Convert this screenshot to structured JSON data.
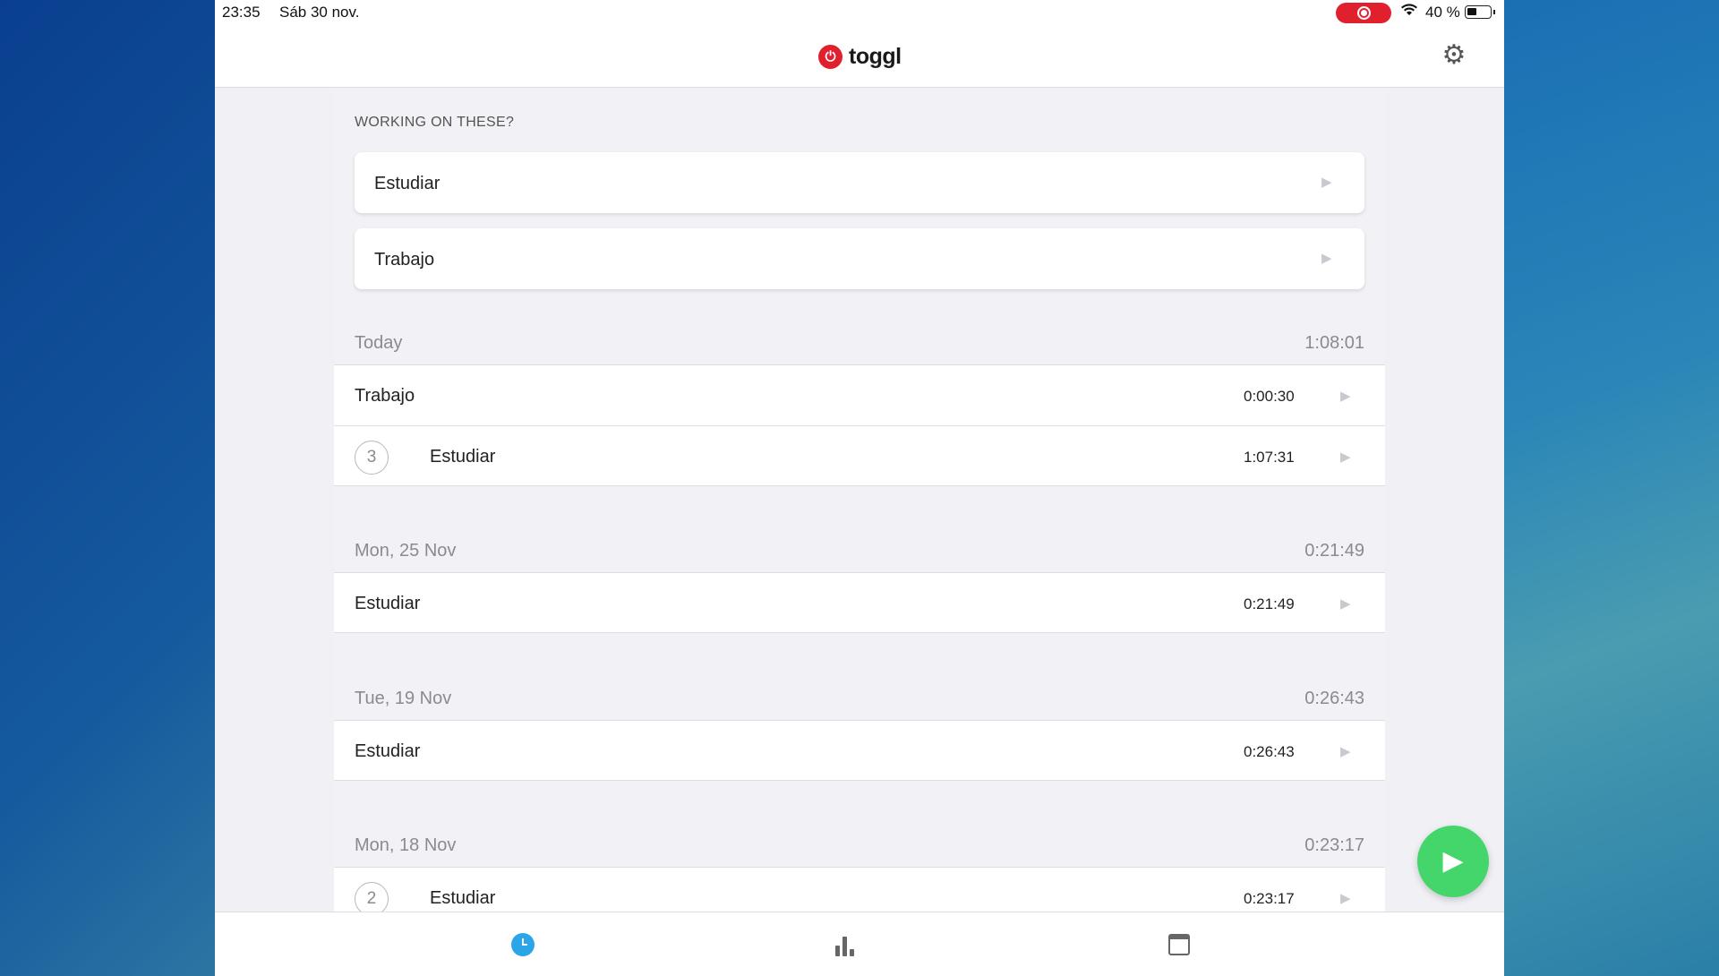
{
  "status_bar": {
    "time": "23:35",
    "date": "Sáb 30 nov.",
    "battery": "40 %",
    "recording_color": "#e0202d"
  },
  "header": {
    "logo_text": "toggl",
    "brand_color": "#e0202d",
    "settings_icon": "gear-icon"
  },
  "suggestions": {
    "title": "WORKING ON THESE?",
    "items": [
      {
        "label": "Estudiar"
      },
      {
        "label": "Trabajo"
      }
    ]
  },
  "groups": [
    {
      "date": "Today",
      "total": "1:08:01",
      "entries": [
        {
          "name": "Trabajo",
          "duration": "0:00:30"
        },
        {
          "count": "3",
          "name": "Estudiar",
          "duration": "1:07:31"
        }
      ]
    },
    {
      "date": "Mon, 25 Nov",
      "total": "0:21:49",
      "entries": [
        {
          "name": "Estudiar",
          "duration": "0:21:49"
        }
      ]
    },
    {
      "date": "Tue, 19 Nov",
      "total": "0:26:43",
      "entries": [
        {
          "name": "Estudiar",
          "duration": "0:26:43"
        }
      ]
    },
    {
      "date": "Mon, 18 Nov",
      "total": "0:23:17",
      "entries": [
        {
          "count": "2",
          "name": "Estudiar",
          "duration": "0:23:17"
        }
      ]
    }
  ],
  "fab": {
    "icon": "play-icon",
    "color": "#44d66a"
  },
  "tabbar": {
    "active_color": "#2aa5e8",
    "tabs": [
      {
        "icon": "clock-icon",
        "active": true
      },
      {
        "icon": "bar-chart-icon",
        "active": false
      },
      {
        "icon": "calendar-icon",
        "active": false
      }
    ]
  }
}
